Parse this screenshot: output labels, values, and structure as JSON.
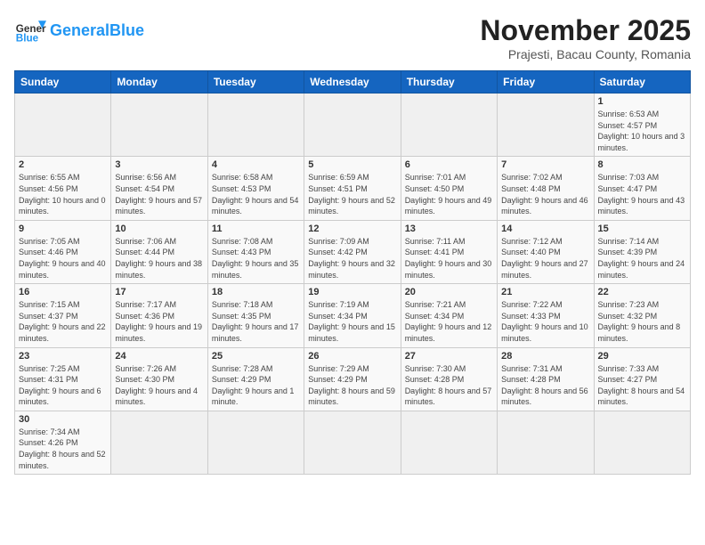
{
  "header": {
    "logo_general": "General",
    "logo_blue": "Blue",
    "month_title": "November 2025",
    "subtitle": "Prajesti, Bacau County, Romania"
  },
  "days_of_week": [
    "Sunday",
    "Monday",
    "Tuesday",
    "Wednesday",
    "Thursday",
    "Friday",
    "Saturday"
  ],
  "weeks": [
    [
      {
        "day": "",
        "info": ""
      },
      {
        "day": "",
        "info": ""
      },
      {
        "day": "",
        "info": ""
      },
      {
        "day": "",
        "info": ""
      },
      {
        "day": "",
        "info": ""
      },
      {
        "day": "",
        "info": ""
      },
      {
        "day": "1",
        "info": "Sunrise: 6:53 AM\nSunset: 4:57 PM\nDaylight: 10 hours\nand 3 minutes."
      }
    ],
    [
      {
        "day": "2",
        "info": "Sunrise: 6:55 AM\nSunset: 4:56 PM\nDaylight: 10 hours\nand 0 minutes."
      },
      {
        "day": "3",
        "info": "Sunrise: 6:56 AM\nSunset: 4:54 PM\nDaylight: 9 hours\nand 57 minutes."
      },
      {
        "day": "4",
        "info": "Sunrise: 6:58 AM\nSunset: 4:53 PM\nDaylight: 9 hours\nand 54 minutes."
      },
      {
        "day": "5",
        "info": "Sunrise: 6:59 AM\nSunset: 4:51 PM\nDaylight: 9 hours\nand 52 minutes."
      },
      {
        "day": "6",
        "info": "Sunrise: 7:01 AM\nSunset: 4:50 PM\nDaylight: 9 hours\nand 49 minutes."
      },
      {
        "day": "7",
        "info": "Sunrise: 7:02 AM\nSunset: 4:48 PM\nDaylight: 9 hours\nand 46 minutes."
      },
      {
        "day": "8",
        "info": "Sunrise: 7:03 AM\nSunset: 4:47 PM\nDaylight: 9 hours\nand 43 minutes."
      }
    ],
    [
      {
        "day": "9",
        "info": "Sunrise: 7:05 AM\nSunset: 4:46 PM\nDaylight: 9 hours\nand 40 minutes."
      },
      {
        "day": "10",
        "info": "Sunrise: 7:06 AM\nSunset: 4:44 PM\nDaylight: 9 hours\nand 38 minutes."
      },
      {
        "day": "11",
        "info": "Sunrise: 7:08 AM\nSunset: 4:43 PM\nDaylight: 9 hours\nand 35 minutes."
      },
      {
        "day": "12",
        "info": "Sunrise: 7:09 AM\nSunset: 4:42 PM\nDaylight: 9 hours\nand 32 minutes."
      },
      {
        "day": "13",
        "info": "Sunrise: 7:11 AM\nSunset: 4:41 PM\nDaylight: 9 hours\nand 30 minutes."
      },
      {
        "day": "14",
        "info": "Sunrise: 7:12 AM\nSunset: 4:40 PM\nDaylight: 9 hours\nand 27 minutes."
      },
      {
        "day": "15",
        "info": "Sunrise: 7:14 AM\nSunset: 4:39 PM\nDaylight: 9 hours\nand 24 minutes."
      }
    ],
    [
      {
        "day": "16",
        "info": "Sunrise: 7:15 AM\nSunset: 4:37 PM\nDaylight: 9 hours\nand 22 minutes."
      },
      {
        "day": "17",
        "info": "Sunrise: 7:17 AM\nSunset: 4:36 PM\nDaylight: 9 hours\nand 19 minutes."
      },
      {
        "day": "18",
        "info": "Sunrise: 7:18 AM\nSunset: 4:35 PM\nDaylight: 9 hours\nand 17 minutes."
      },
      {
        "day": "19",
        "info": "Sunrise: 7:19 AM\nSunset: 4:34 PM\nDaylight: 9 hours\nand 15 minutes."
      },
      {
        "day": "20",
        "info": "Sunrise: 7:21 AM\nSunset: 4:34 PM\nDaylight: 9 hours\nand 12 minutes."
      },
      {
        "day": "21",
        "info": "Sunrise: 7:22 AM\nSunset: 4:33 PM\nDaylight: 9 hours\nand 10 minutes."
      },
      {
        "day": "22",
        "info": "Sunrise: 7:23 AM\nSunset: 4:32 PM\nDaylight: 9 hours\nand 8 minutes."
      }
    ],
    [
      {
        "day": "23",
        "info": "Sunrise: 7:25 AM\nSunset: 4:31 PM\nDaylight: 9 hours\nand 6 minutes."
      },
      {
        "day": "24",
        "info": "Sunrise: 7:26 AM\nSunset: 4:30 PM\nDaylight: 9 hours\nand 4 minutes."
      },
      {
        "day": "25",
        "info": "Sunrise: 7:28 AM\nSunset: 4:29 PM\nDaylight: 9 hours\nand 1 minute."
      },
      {
        "day": "26",
        "info": "Sunrise: 7:29 AM\nSunset: 4:29 PM\nDaylight: 8 hours\nand 59 minutes."
      },
      {
        "day": "27",
        "info": "Sunrise: 7:30 AM\nSunset: 4:28 PM\nDaylight: 8 hours\nand 57 minutes."
      },
      {
        "day": "28",
        "info": "Sunrise: 7:31 AM\nSunset: 4:28 PM\nDaylight: 8 hours\nand 56 minutes."
      },
      {
        "day": "29",
        "info": "Sunrise: 7:33 AM\nSunset: 4:27 PM\nDaylight: 8 hours\nand 54 minutes."
      }
    ],
    [
      {
        "day": "30",
        "info": "Sunrise: 7:34 AM\nSunset: 4:26 PM\nDaylight: 8 hours\nand 52 minutes."
      },
      {
        "day": "",
        "info": ""
      },
      {
        "day": "",
        "info": ""
      },
      {
        "day": "",
        "info": ""
      },
      {
        "day": "",
        "info": ""
      },
      {
        "day": "",
        "info": ""
      },
      {
        "day": "",
        "info": ""
      }
    ]
  ]
}
